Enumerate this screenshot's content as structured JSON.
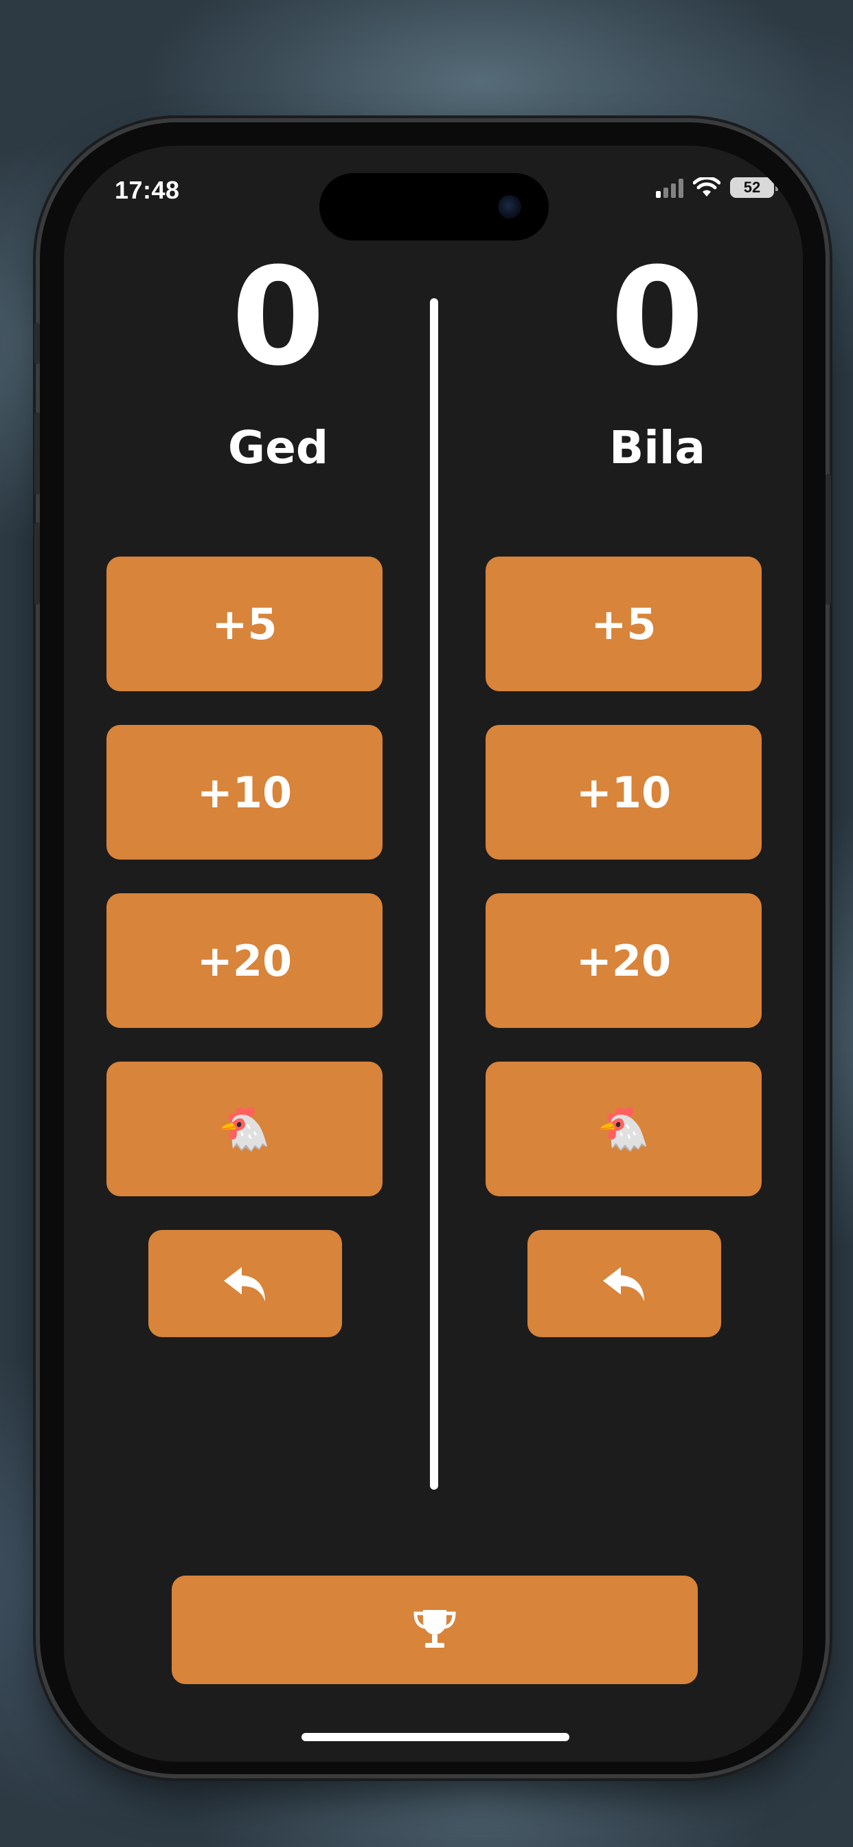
{
  "status_bar": {
    "time": "17:48",
    "battery": "52",
    "icons": [
      "signal-icon",
      "wifi-icon",
      "battery-icon"
    ]
  },
  "players": [
    {
      "score": "0",
      "name": "Ged",
      "buttons": [
        {
          "label": "+5"
        },
        {
          "label": "+10"
        },
        {
          "label": "+20"
        },
        {
          "label": "🐔",
          "icon": "chicken-icon"
        }
      ],
      "undo_icon": "undo-arrow-icon"
    },
    {
      "score": "0",
      "name": "Bila",
      "buttons": [
        {
          "label": "+5"
        },
        {
          "label": "+10"
        },
        {
          "label": "+20"
        },
        {
          "label": "🐔",
          "icon": "chicken-icon"
        }
      ],
      "undo_icon": "undo-arrow-icon"
    }
  ],
  "bottom_button": {
    "icon": "trophy-icon"
  },
  "colors": {
    "background": "#1c1c1c",
    "accent": "#d8843a",
    "text": "#ffffff"
  }
}
